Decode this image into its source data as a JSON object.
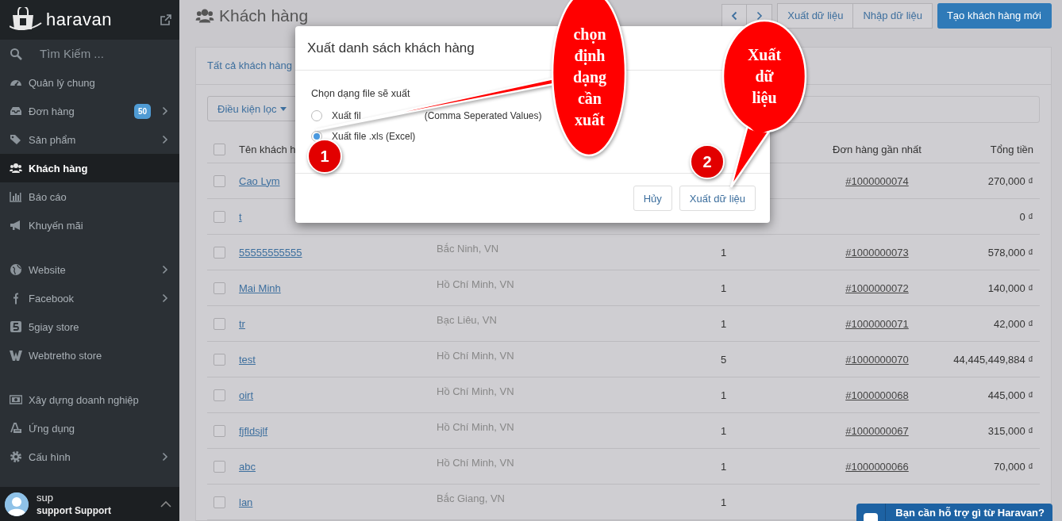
{
  "sidebar": {
    "brand": "haravan",
    "search": {
      "placeholder": "Tìm Kiếm ..."
    },
    "groups": [
      {
        "items": [
          {
            "label": "Quản lý chung",
            "expandable": false,
            "selected": false
          },
          {
            "label": "Đơn hàng",
            "badge": "50",
            "expandable": true,
            "selected": false
          },
          {
            "label": "Sản phẩm",
            "expandable": true,
            "selected": false
          },
          {
            "label": "Khách hàng",
            "expandable": false,
            "selected": true
          },
          {
            "label": "Báo cáo",
            "expandable": false,
            "selected": false
          },
          {
            "label": "Khuyến mãi",
            "expandable": false,
            "selected": false
          }
        ]
      },
      {
        "items": [
          {
            "label": "Website",
            "expandable": true,
            "selected": false
          },
          {
            "label": "Facebook",
            "expandable": true,
            "selected": false
          },
          {
            "label": "5giay store",
            "expandable": false,
            "selected": false
          },
          {
            "label": "Webtretho store",
            "expandable": false,
            "selected": false
          }
        ]
      },
      {
        "items": [
          {
            "label": "Xây dựng doanh nghiệp",
            "expandable": false,
            "selected": false
          },
          {
            "label": "Ứng dụng",
            "expandable": false,
            "selected": false
          },
          {
            "label": "Cấu hình",
            "expandable": true,
            "selected": false
          }
        ]
      }
    ],
    "user": {
      "name": "sup",
      "full_name": "support Support"
    }
  },
  "header": {
    "title": "Khách hàng",
    "buttons": [
      {
        "label": "Xuất dữ liệu",
        "kind": "default"
      },
      {
        "label": "Nhập dữ liệu",
        "kind": "default"
      },
      {
        "label": "Tạo khách hàng mới",
        "kind": "primary"
      }
    ]
  },
  "customers": {
    "tabs": [
      {
        "label": "Tất cả khách hàng",
        "selected": true
      }
    ],
    "filter": "Điều kiện lọc",
    "table": {
      "all_checked": false,
      "headers": {
        "name": "Tên khách h",
        "last_order": "Đơn hàng gần nhất",
        "total": "Tổng tiền"
      },
      "rows": [
        {
          "name": "Cao Lym",
          "last_order": "#1000000074",
          "total": "270,000 ₫",
          "checked": false
        },
        {
          "name": "t",
          "total": "0 ₫",
          "checked": false
        },
        {
          "name": "55555555555",
          "address": "Bắc Ninh, VN",
          "orders": "1",
          "last_order": "#1000000073",
          "total": "578,000 ₫",
          "checked": false
        },
        {
          "name": "Mai Minh",
          "address": "Hồ Chí Minh, VN",
          "orders": "1",
          "last_order": "#1000000072",
          "total": "140,000 ₫",
          "checked": false
        },
        {
          "name": "tr",
          "address": "Bạc Liêu, VN",
          "orders": "1",
          "last_order": "#1000000071",
          "total": "42,000 ₫",
          "checked": false
        },
        {
          "name": "test",
          "address": "Hồ Chí Minh, VN",
          "orders": "5",
          "last_order": "#1000000070",
          "total": "44,445,449,884 ₫",
          "checked": false
        },
        {
          "name": "oirt",
          "address": "Hồ Chí Minh, VN",
          "orders": "1",
          "last_order": "#1000000068",
          "total": "445,000 ₫",
          "checked": false
        },
        {
          "name": "fjfldsjlf",
          "address": "Hồ Chí Minh, VN",
          "orders": "1",
          "last_order": "#1000000067",
          "total": "315,000 ₫",
          "checked": false
        },
        {
          "name": "abc",
          "address": "Hồ Chí Minh, VN",
          "orders": "1",
          "last_order": "#1000000066",
          "total": "70,000 ₫",
          "checked": false
        },
        {
          "name": "lan",
          "address": "Bắc Giang, VN",
          "orders": "1",
          "checked": false
        }
      ]
    }
  },
  "modal": {
    "title": "Xuất danh sách khách hàng",
    "prompt": "Chọn dạng file sẽ xuất",
    "options": [
      {
        "label_parts": [
          "Xuất fil",
          "(Comma Seperated Values)"
        ],
        "selected": false
      },
      {
        "label_parts": [
          "Xuất file .xls (Excel)"
        ],
        "selected": true
      }
    ],
    "buttons": [
      "Hủy",
      "Xuất dữ liệu"
    ]
  },
  "annotations": [
    {
      "text": "chọn định dạng cần xuất"
    },
    {
      "text": "Xuất dữ liệu"
    }
  ],
  "markers": [
    "1",
    "2"
  ],
  "chat": {
    "label": "Bạn cần hỗ trợ gì từ Haravan?"
  }
}
